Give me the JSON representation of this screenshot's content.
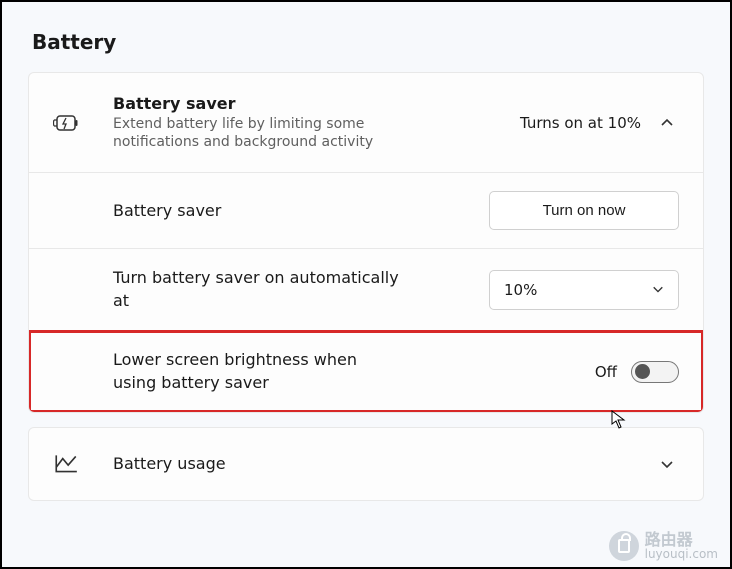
{
  "section_title": "Battery",
  "battery_saver": {
    "title": "Battery saver",
    "description": "Extend battery life by limiting some notifications and background activity",
    "status": "Turns on at 10%",
    "sub_label": "Battery saver",
    "turn_on_button": "Turn on now",
    "auto_label": "Turn battery saver on automatically at",
    "auto_value": "10%",
    "brightness_label": "Lower screen brightness when using battery saver",
    "brightness_state": "Off"
  },
  "battery_usage": {
    "title": "Battery usage"
  },
  "watermark": {
    "brand": "路由器",
    "domain": "luyouqi.com"
  }
}
